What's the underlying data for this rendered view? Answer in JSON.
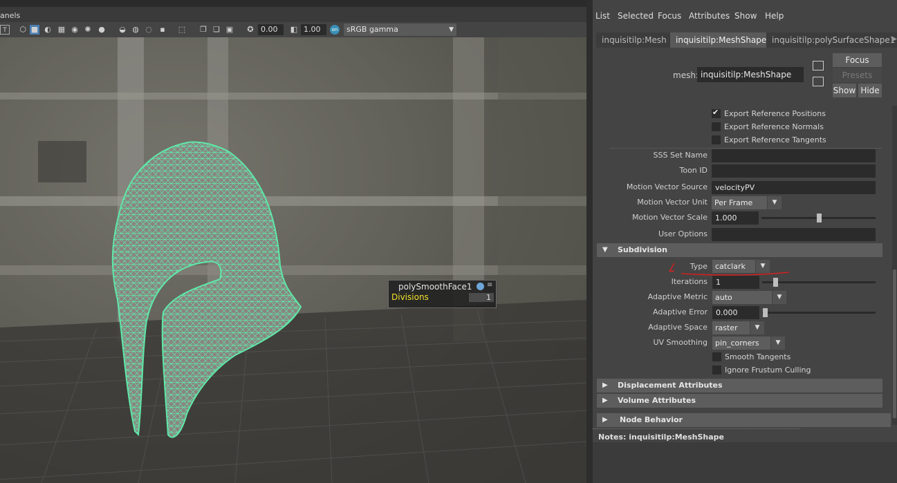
{
  "viewport": {
    "panels_menu": "anels",
    "toolbar": {
      "exposure_value": "0.00",
      "gamma_value": "1.00",
      "color_space": "sRGB gamma"
    },
    "hud": {
      "node_name": "polySmoothFace1",
      "attr_label": "Divisions",
      "attr_value": "1"
    },
    "wireframe_color": "#5fe8a8"
  },
  "attribute_editor": {
    "menu": [
      "List",
      "Selected",
      "Focus",
      "Attributes",
      "Show",
      "Help"
    ],
    "tabs": [
      {
        "label": "inquisitilp:Mesh",
        "active": false
      },
      {
        "label": "inquisitilp:MeshShape",
        "active": true
      },
      {
        "label": "inquisitilp:polySurfaceShape1",
        "active": false
      }
    ],
    "mesh_label": "mesh:",
    "mesh_value": "inquisitilp:MeshShape",
    "buttons": {
      "focus": "Focus",
      "presets": "Presets",
      "show": "Show",
      "hide": "Hide"
    },
    "export_checkboxes": [
      {
        "label": "Export Reference Positions",
        "checked": true
      },
      {
        "label": "Export Reference Normals",
        "checked": false
      },
      {
        "label": "Export Reference Tangents",
        "checked": false
      }
    ],
    "fields": {
      "sss_set_name": {
        "label": "SSS Set Name",
        "value": ""
      },
      "toon_id": {
        "label": "Toon ID",
        "value": ""
      },
      "motion_vector_source": {
        "label": "Motion Vector Source",
        "value": "velocityPV"
      },
      "motion_vector_unit": {
        "label": "Motion Vector Unit",
        "value": "Per Frame"
      },
      "motion_vector_scale": {
        "label": "Motion Vector Scale",
        "value": "1.000"
      },
      "user_options": {
        "label": "User Options",
        "value": ""
      }
    },
    "subdivision": {
      "title": "Subdivision",
      "type": {
        "label": "Type",
        "value": "catclark"
      },
      "iterations": {
        "label": "Iterations",
        "value": "1"
      },
      "adaptive_metric": {
        "label": "Adaptive Metric",
        "value": "auto"
      },
      "adaptive_error": {
        "label": "Adaptive Error",
        "value": "0.000"
      },
      "adaptive_space": {
        "label": "Adaptive Space",
        "value": "raster"
      },
      "uv_smoothing": {
        "label": "UV Smoothing",
        "value": "pin_corners"
      },
      "smooth_tangents": {
        "label": "Smooth Tangents",
        "checked": false
      },
      "ignore_frustum": {
        "label": "Ignore Frustum Culling",
        "checked": false
      }
    },
    "sections": {
      "displacement": "Displacement Attributes",
      "volume": "Volume Attributes",
      "node_behavior": "Node Behavior"
    },
    "notes_label": "Notes:  inquisitilp:MeshShape",
    "annotation_color": "#d42020"
  }
}
